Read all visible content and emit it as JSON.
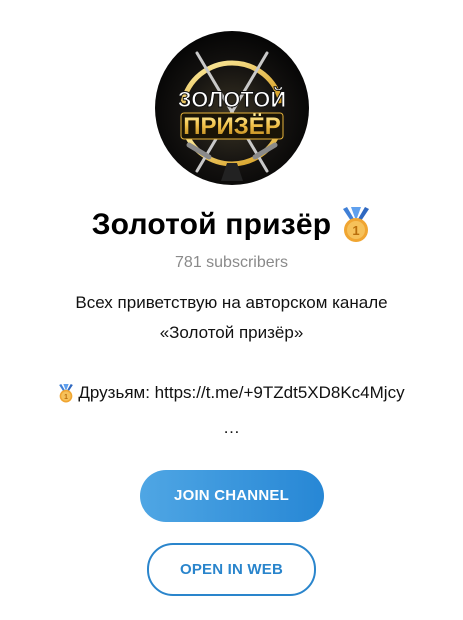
{
  "channel": {
    "title": "Золотой призёр",
    "subscribers": "781 subscribers",
    "avatar_text": "ЗОЛОТОЙ ПРИЗЁР"
  },
  "description": {
    "line1": "Всех приветствую на авторском канале",
    "line2": "«Золотой призёр»",
    "friends": "Друзьям: https://t.me/+9TZdt5XD8Kc4Mjcy",
    "ellipsis": "…"
  },
  "actions": {
    "join_label": "JOIN CHANNEL",
    "web_label": "OPEN IN WEB"
  },
  "icons": {
    "title_icon": "gold-medal-icon",
    "friends_icon": "gold-medal-icon"
  },
  "colors": {
    "accent": "#2a85cc",
    "join_gradient_start": "#4fa6e4",
    "join_gradient_end": "#2787d5",
    "medal_gold": "#f0a531",
    "avatar_bg": "#0b0b0b"
  }
}
